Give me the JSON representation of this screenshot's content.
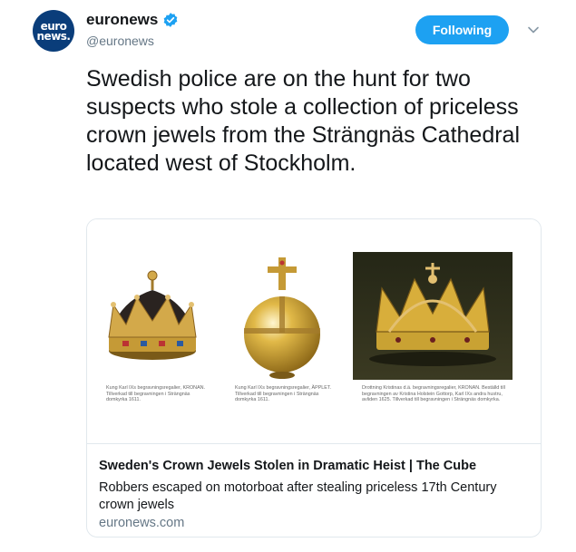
{
  "author": {
    "avatar_text_line1": "euro",
    "avatar_text_line2": "news.",
    "display_name": "euronews",
    "handle": "@euronews",
    "verified": true
  },
  "follow_button": {
    "label": "Following"
  },
  "menu": {
    "icon": "chevron-down-icon"
  },
  "tweet": {
    "text": "Swedish police are on the hunt for two suspects who stole a collection of priceless crown jewels from the Strängnäs Cathedral located west of Stockholm."
  },
  "card": {
    "images": [
      {
        "subject": "crown",
        "caption": "Kung Karl IXs begravningsregalier, KRONAN. Tillverkad till begravningen i Strängnäs domkyrka 1611."
      },
      {
        "subject": "orb",
        "caption": "Kung Karl IXs begravningsregalier, ÄPPLET. Tillverkad till begravningen i Strängnäs domkyrka 1611."
      },
      {
        "subject": "crown-photo",
        "caption": "Drottning Kristinas d.ä. begravningsregalier, KRONAN. Beställd till begravningen av Kristina Holstein Gottorp, Karl IXs andra hustru, avliden 1625. Tillverkad till begravningen i Strängnäs domkyrka."
      }
    ],
    "title": "Sweden's Crown Jewels Stolen in Dramatic Heist | The Cube",
    "description": "Robbers escaped on motorboat after stealing priceless 17th Century crown jewels",
    "domain": "euronews.com"
  },
  "colors": {
    "accent": "#1da1f2",
    "avatar_bg": "#0a3d7a",
    "gold": "#c9a233",
    "muted": "#657786",
    "border": "#e1e8ed"
  }
}
